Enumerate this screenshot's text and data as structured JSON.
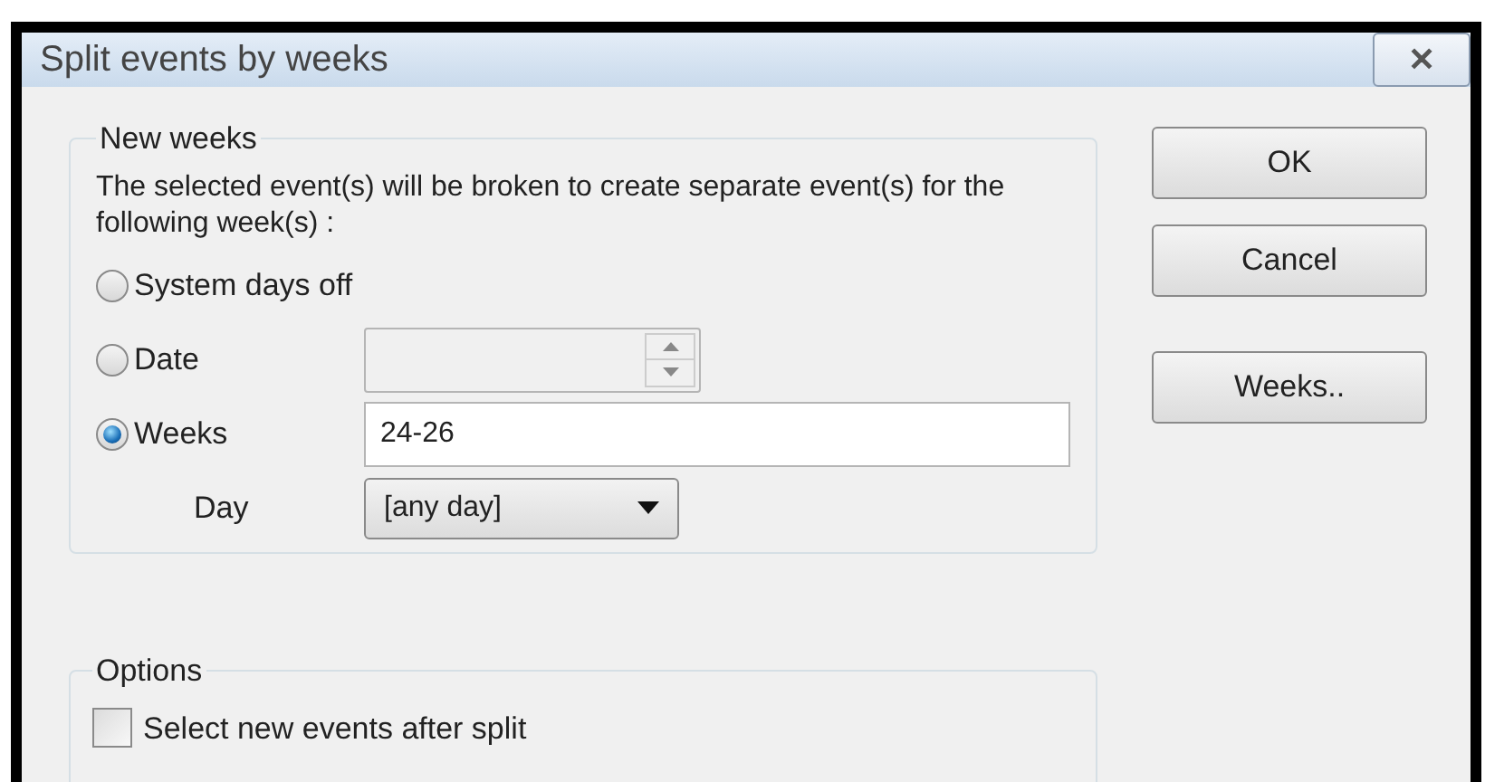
{
  "window": {
    "title": "Split events by weeks",
    "close": "✕"
  },
  "new_weeks": {
    "legend": "New weeks",
    "description": "The selected event(s) will be broken to create separate event(s) for the following week(s) :",
    "options": [
      {
        "kind": "plain",
        "label": "System days off",
        "selected": false
      },
      {
        "kind": "date",
        "label": "Date",
        "selected": false,
        "disabled": true
      },
      {
        "kind": "text",
        "label": "Weeks",
        "selected": true,
        "value": "24-26"
      }
    ],
    "day": {
      "label": "Day",
      "value": "[any day]"
    }
  },
  "options": {
    "legend": "Options",
    "checkboxes": [
      {
        "label": "Select new events after split",
        "checked": false
      }
    ]
  },
  "buttons": [
    {
      "label": "OK"
    },
    {
      "label": "Cancel"
    },
    {
      "label": "Weeks.."
    }
  ]
}
